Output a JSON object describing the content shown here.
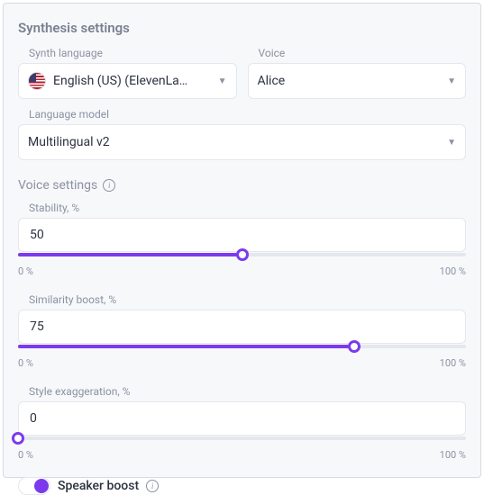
{
  "title": "Synthesis settings",
  "fields": {
    "synth_language": {
      "label": "Synth language",
      "value": "English (US) (ElevenLa…"
    },
    "voice": {
      "label": "Voice",
      "value": "Alice"
    },
    "language_model": {
      "label": "Language model",
      "value": "Multilingual v2"
    }
  },
  "voice_settings": {
    "title": "Voice settings",
    "stability": {
      "label": "Stability, %",
      "value": "50",
      "percent": 50,
      "min_label": "0 %",
      "max_label": "100 %"
    },
    "similarity": {
      "label": "Similarity boost, %",
      "value": "75",
      "percent": 75,
      "min_label": "0 %",
      "max_label": "100 %"
    },
    "style": {
      "label": "Style exaggeration, %",
      "value": "0",
      "percent": 0,
      "min_label": "0 %",
      "max_label": "100 %"
    },
    "speaker_boost": {
      "label": "Speaker boost",
      "on": true
    }
  }
}
